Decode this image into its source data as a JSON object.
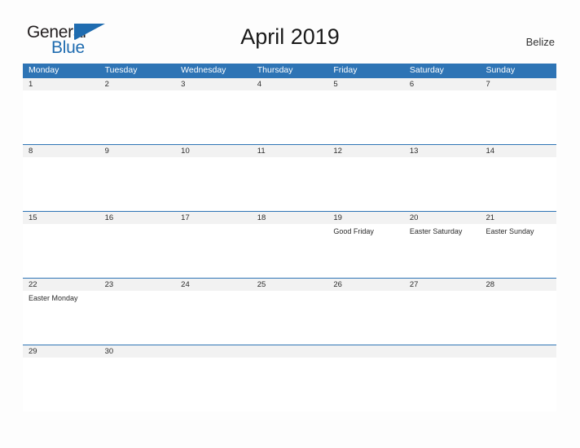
{
  "brand": {
    "name_top": "General",
    "name_bottom": "Blue",
    "triangle_color": "#1f6cb0",
    "text_color": "#231f20"
  },
  "header": {
    "title": "April 2019",
    "country": "Belize"
  },
  "theme": {
    "header_blue": "#2e74b5",
    "date_band_gray": "#f2f2f2",
    "page_background": "#fdfdfd",
    "text_color": "#2b2b2b"
  },
  "calendar": {
    "month": "April",
    "year": "2019",
    "day_headers": [
      "Monday",
      "Tuesday",
      "Wednesday",
      "Thursday",
      "Friday",
      "Saturday",
      "Sunday"
    ],
    "weeks": [
      {
        "dates": [
          "1",
          "2",
          "3",
          "4",
          "5",
          "6",
          "7"
        ],
        "events": [
          "",
          "",
          "",
          "",
          "",
          "",
          ""
        ]
      },
      {
        "dates": [
          "8",
          "9",
          "10",
          "11",
          "12",
          "13",
          "14"
        ],
        "events": [
          "",
          "",
          "",
          "",
          "",
          "",
          ""
        ]
      },
      {
        "dates": [
          "15",
          "16",
          "17",
          "18",
          "19",
          "20",
          "21"
        ],
        "events": [
          "",
          "",
          "",
          "",
          "Good Friday",
          "Easter Saturday",
          "Easter Sunday"
        ]
      },
      {
        "dates": [
          "22",
          "23",
          "24",
          "25",
          "26",
          "27",
          "28"
        ],
        "events": [
          "Easter Monday",
          "",
          "",
          "",
          "",
          "",
          ""
        ]
      },
      {
        "dates": [
          "29",
          "30",
          "",
          "",
          "",
          "",
          ""
        ],
        "events": [
          "",
          "",
          "",
          "",
          "",
          "",
          ""
        ]
      }
    ]
  }
}
